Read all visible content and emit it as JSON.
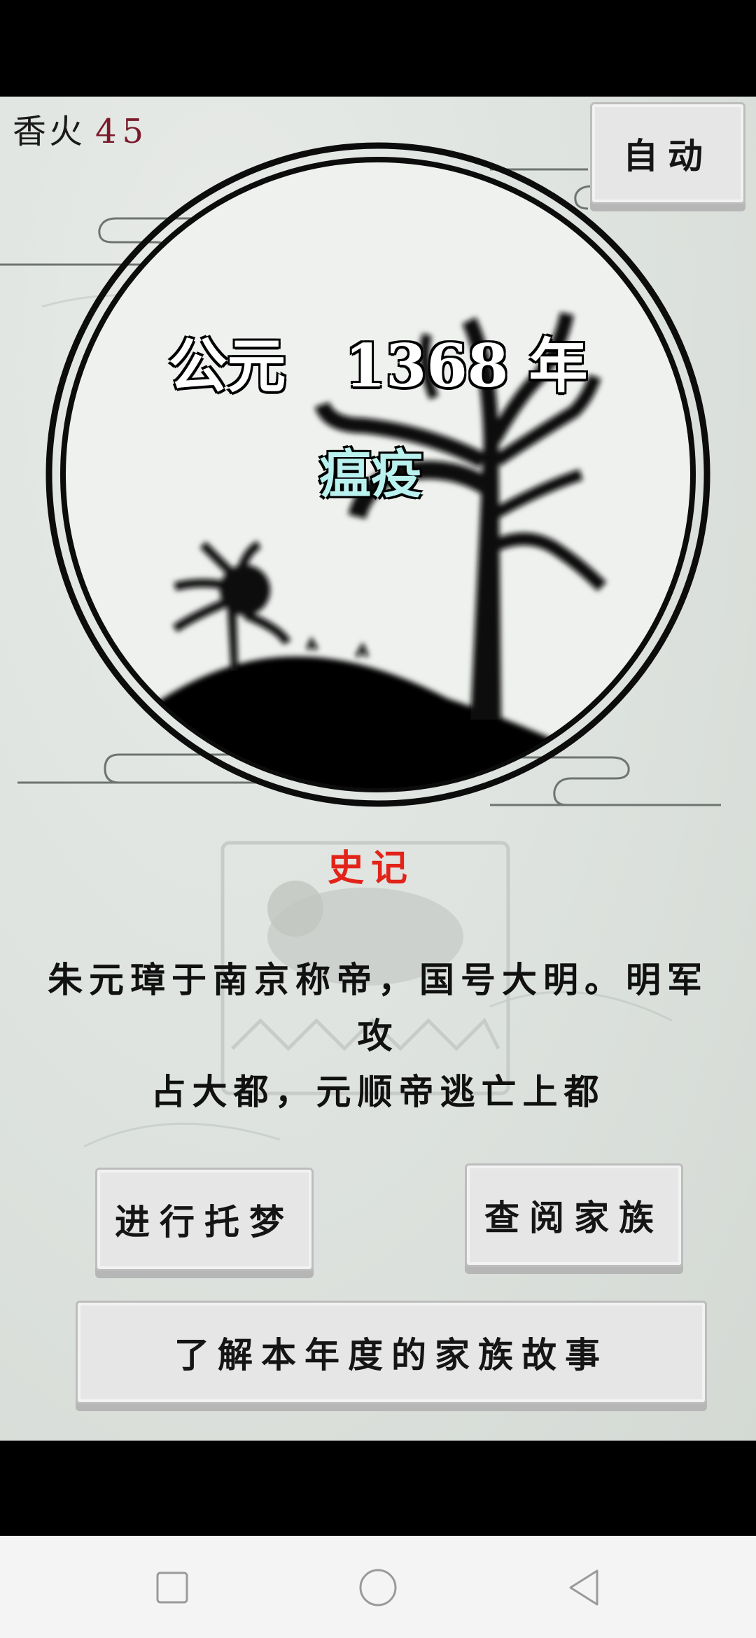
{
  "hud": {
    "incense_label": "香火",
    "incense_value": "45"
  },
  "buttons": {
    "auto": "自动",
    "dream": "进行托梦",
    "family": "查阅家族",
    "story": "了解本年度的家族故事"
  },
  "scene": {
    "year_text": "公元　1368 年",
    "event": "瘟疫"
  },
  "records": {
    "title": "史记",
    "line1": "朱元璋于南京称帝，国号大明。明军攻",
    "line2": "占大都，元顺帝逃亡上都"
  },
  "colors": {
    "incense_value": "#7a1a2a",
    "records_title": "#e2231a",
    "event_text": "#b9f1ef"
  },
  "icons": {
    "nav_recent": "square-icon",
    "nav_home": "circle-icon",
    "nav_back": "triangle-back-icon"
  }
}
